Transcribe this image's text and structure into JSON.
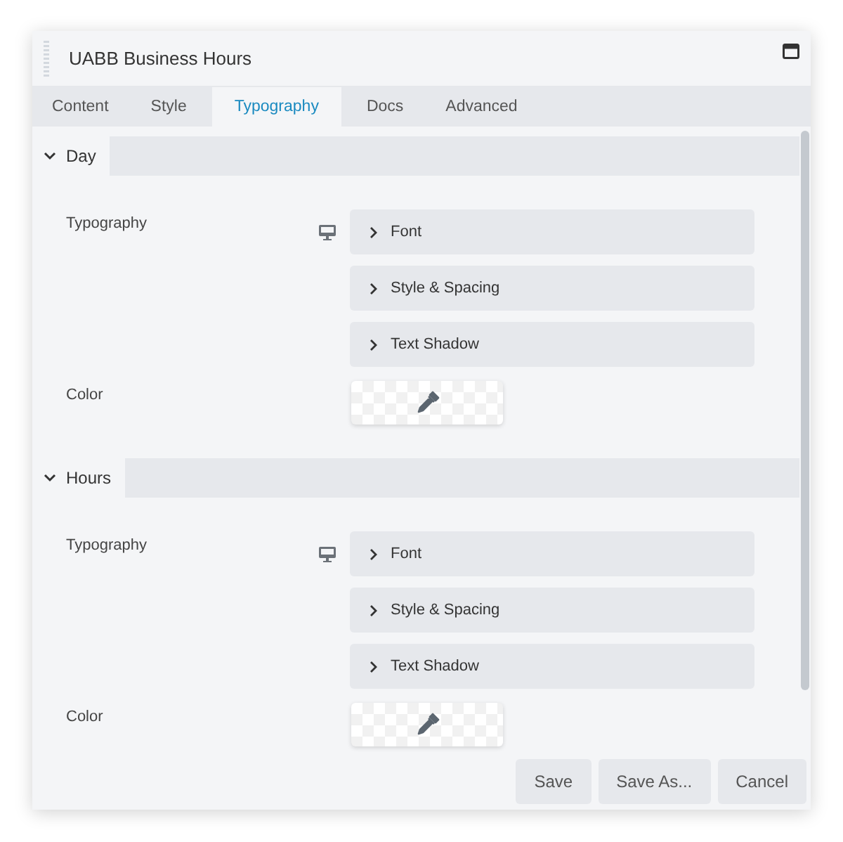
{
  "window": {
    "title": "UABB Business Hours"
  },
  "tabs": [
    {
      "label": "Content",
      "selected": false
    },
    {
      "label": "Style",
      "selected": false
    },
    {
      "label": "Typography",
      "selected": true
    },
    {
      "label": "Docs",
      "selected": false
    },
    {
      "label": "Advanced",
      "selected": false
    }
  ],
  "sections": [
    {
      "title": "Day",
      "expanded": true,
      "fields": [
        {
          "kind": "typography",
          "label": "Typography",
          "groups": [
            "Font",
            "Style & Spacing",
            "Text Shadow"
          ]
        },
        {
          "kind": "color",
          "label": "Color"
        }
      ]
    },
    {
      "title": "Hours",
      "expanded": true,
      "fields": [
        {
          "kind": "typography",
          "label": "Typography",
          "groups": [
            "Font",
            "Style & Spacing",
            "Text Shadow"
          ]
        },
        {
          "kind": "color",
          "label": "Color"
        }
      ]
    }
  ],
  "buttons": [
    "Save",
    "Save As...",
    "Cancel"
  ]
}
